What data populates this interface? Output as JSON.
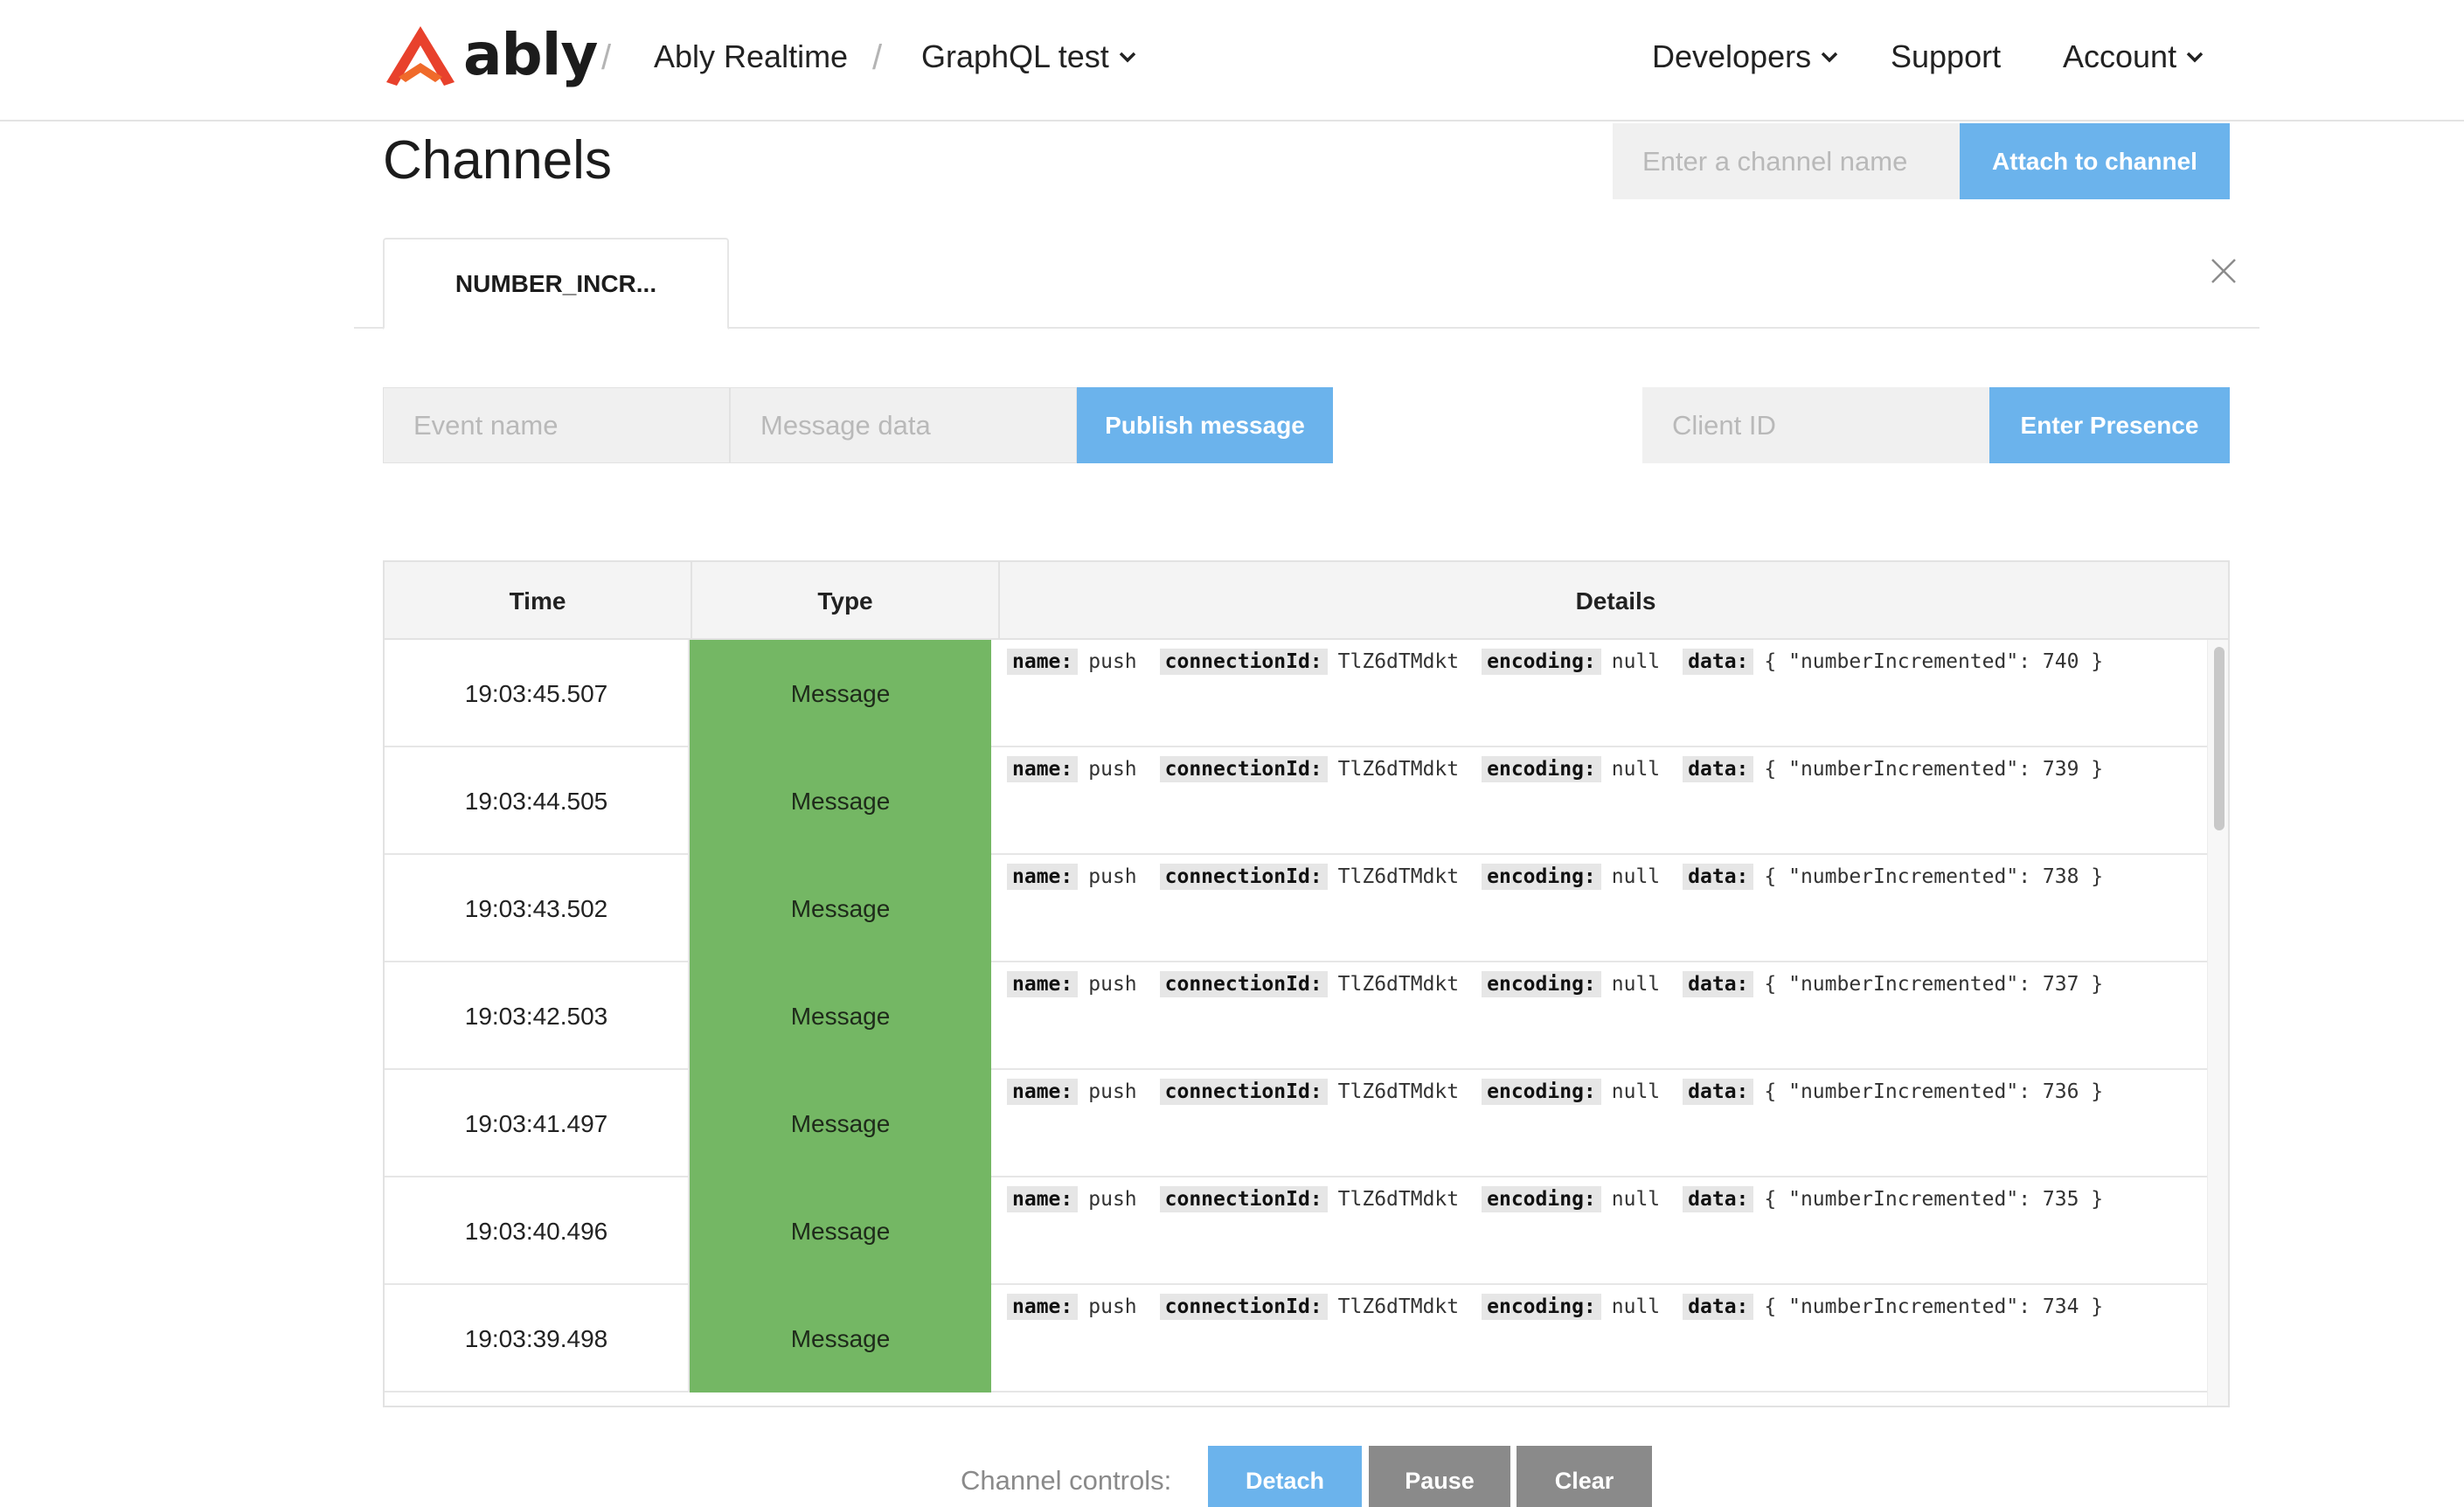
{
  "header": {
    "logo_text": "ably",
    "breadcrumbs": [
      "Ably Realtime",
      "GraphQL test"
    ],
    "nav": [
      "Developers",
      "Support",
      "Account"
    ]
  },
  "page": {
    "title": "Channels",
    "attach_placeholder": "Enter a channel name",
    "attach_button": "Attach to channel"
  },
  "tab": {
    "label": "NUMBER_INCR..."
  },
  "publish": {
    "event_placeholder": "Event name",
    "data_placeholder": "Message data",
    "publish_button": "Publish message",
    "client_placeholder": "Client ID",
    "presence_button": "Enter Presence"
  },
  "table": {
    "headers": [
      "Time",
      "Type",
      "Details"
    ],
    "detail_keys": [
      "name:",
      "connectionId:",
      "encoding:",
      "data:"
    ],
    "rows": [
      {
        "time": "19:03:45.507",
        "type": "Message",
        "name": "push",
        "connectionId": "TlZ6dTMdkt",
        "encoding": "null",
        "data": "{ \"numberIncremented\": 740 }"
      },
      {
        "time": "19:03:44.505",
        "type": "Message",
        "name": "push",
        "connectionId": "TlZ6dTMdkt",
        "encoding": "null",
        "data": "{ \"numberIncremented\": 739 }"
      },
      {
        "time": "19:03:43.502",
        "type": "Message",
        "name": "push",
        "connectionId": "TlZ6dTMdkt",
        "encoding": "null",
        "data": "{ \"numberIncremented\": 738 }"
      },
      {
        "time": "19:03:42.503",
        "type": "Message",
        "name": "push",
        "connectionId": "TlZ6dTMdkt",
        "encoding": "null",
        "data": "{ \"numberIncremented\": 737 }"
      },
      {
        "time": "19:03:41.497",
        "type": "Message",
        "name": "push",
        "connectionId": "TlZ6dTMdkt",
        "encoding": "null",
        "data": "{ \"numberIncremented\": 736 }"
      },
      {
        "time": "19:03:40.496",
        "type": "Message",
        "name": "push",
        "connectionId": "TlZ6dTMdkt",
        "encoding": "null",
        "data": "{ \"numberIncremented\": 735 }"
      },
      {
        "time": "19:03:39.498",
        "type": "Message",
        "name": "push",
        "connectionId": "TlZ6dTMdkt",
        "encoding": "null",
        "data": "{ \"numberIncremented\": 734 }"
      }
    ]
  },
  "controls": {
    "label": "Channel controls:",
    "detach": "Detach",
    "pause": "Pause",
    "clear": "Clear"
  },
  "colors": {
    "accent_blue": "#6bb3ec",
    "message_green": "#74b764",
    "gray_button": "#8a8a8a",
    "logo_red": "#e8412c"
  }
}
